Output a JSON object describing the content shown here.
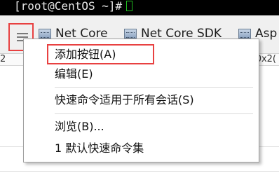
{
  "terminal": {
    "prompt": "[root@CentOS ~]#"
  },
  "toolbar": {
    "buttons": [
      {
        "label": "Net Core",
        "icon": "quick-command-icon"
      },
      {
        "label": "Net Core SDK",
        "icon": "quick-command-icon"
      },
      {
        "label": "Asp",
        "icon": "quick-command-icon"
      }
    ]
  },
  "status_row": {
    "left": "2",
    "right": "0x2("
  },
  "menu": {
    "items": [
      {
        "label": "添加按钮(A)"
      },
      {
        "label": "编辑(E)"
      },
      {
        "label": "快速命令适用于所有会话(S)"
      },
      {
        "label": "浏览(B)..."
      },
      {
        "label": "1 默认快速命令集"
      }
    ]
  },
  "colors": {
    "highlight_box": "#e84141",
    "cursor": "#1fb91f"
  }
}
